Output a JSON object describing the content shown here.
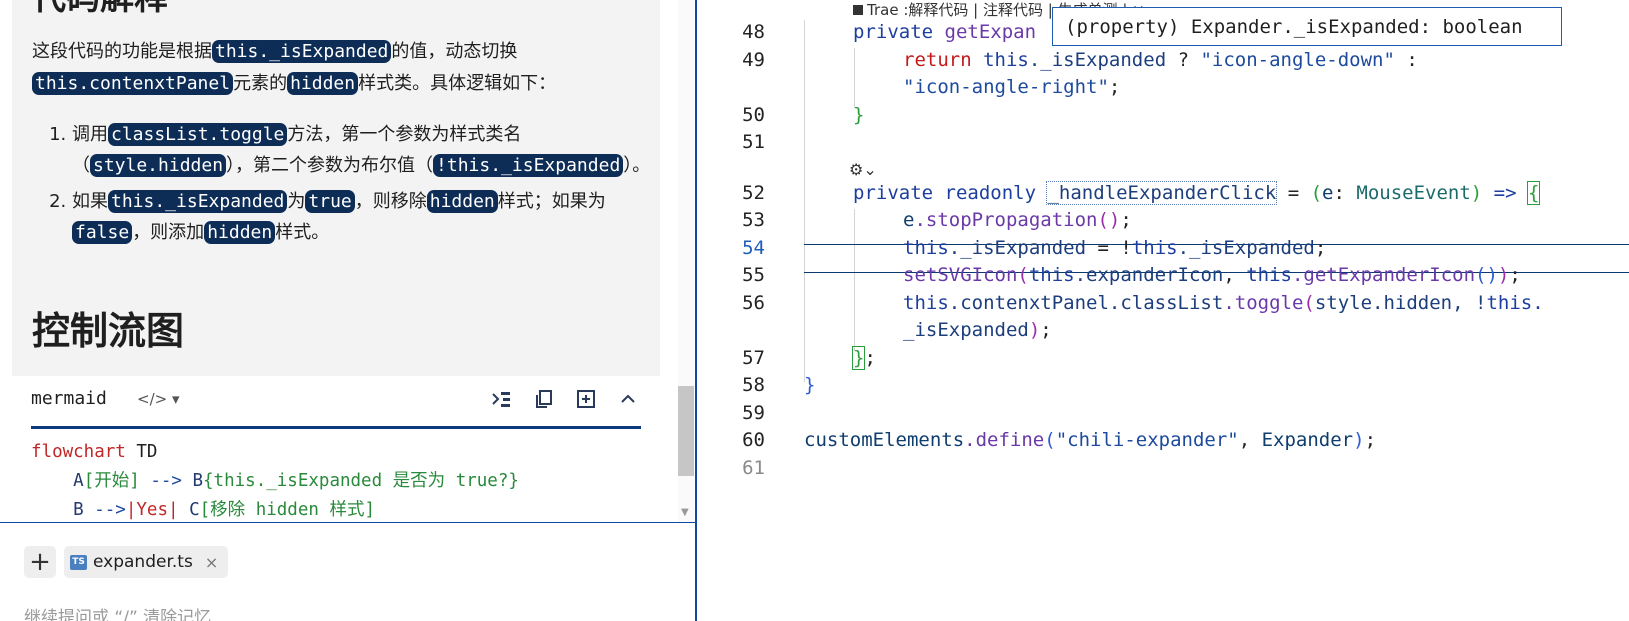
{
  "answer": {
    "heading_top": "代码解释",
    "para_prefix": "这段代码的功能是根据",
    "para_code1": "this._isExpanded",
    "para_mid": "的值，动态切换",
    "para_code2": "this.contenxtPanel",
    "para_mid2": "元素的",
    "para_code3": "hidden",
    "para_suffix": "样式类。具体逻辑如下：",
    "steps": [
      {
        "t1": "调用",
        "c1": "classList.toggle",
        "t2": "方法，第一个参数为样式类名（",
        "c2": "style.hidden",
        "t3": "），第二个参数为布尔值（",
        "c3": "!this._isExpanded",
        "t4": "）。"
      },
      {
        "t1": "如果",
        "c1": "this._isExpanded",
        "t2": "为",
        "c2": "true",
        "t3": "，则移除",
        "c3": "hidden",
        "t4": "样式；如果为",
        "c4": "false",
        "t5": "，则添加",
        "c5": "hidden",
        "t6": "样式。"
      }
    ],
    "heading2": "控制流图"
  },
  "code_block": {
    "lang": "mermaid",
    "tag_icon": "</>",
    "line1_kw": "flowchart",
    "line1_rest": " TD",
    "line2_a": "A",
    "line2_a_text": "[开始]",
    "line2_arrow": " --> ",
    "line2_b": "B",
    "line2_b_text": "{this._isExpanded 是否为 true?}",
    "line3_b": "B",
    "line3_arrow": " -->",
    "line3_label": "|Yes|",
    "line3_c": " C",
    "line3_c_text": "[移除 hidden 样式]"
  },
  "chat_input": {
    "add_label": "+",
    "file_chip_name": "expander.ts",
    "file_chip_icon": "TS",
    "close_label": "×",
    "placeholder": "继续提问或 “/” 清除记忆"
  },
  "editor": {
    "codelens": "Trae :解释代码 | 注释代码 | 生成单测 | ×",
    "hover_text": "(property) Expander._isExpanded: boolean",
    "line_numbers": [
      "48",
      "49",
      "",
      "50",
      "51",
      "",
      "52",
      "53",
      "54",
      "55",
      "56",
      "",
      "57",
      "58",
      "59",
      "60",
      "61"
    ],
    "active_line": "54",
    "lines": {
      "l48_kw": "private",
      "l48_fn": "getExpan",
      "l49_ret": "return",
      "l49_this": "this",
      "l49_prop": "._isExpanded",
      "l49_q": " ? ",
      "l49_s1": "\"icon-angle-down\"",
      "l49_colon": " :",
      "l49b_s2": "\"icon-angle-right\"",
      "l49b_semi": ";",
      "l50": "}",
      "l52_kw": "private readonly",
      "l52_name": "_handleExpanderClick",
      "l52_eq": " = ",
      "l52_p1": "(",
      "l52_e": "e",
      "l52_colon": ": ",
      "l52_type": "MouseEvent",
      "l52_p2": ")",
      "l52_arrow": " => ",
      "l52_brace": "{",
      "l53_e": "e",
      "l53_fn": ".stopPropagation",
      "l53_paren": "()",
      "l53_semi": ";",
      "l54_this": "this",
      "l54_prop": "._isExpanded",
      "l54_eq": " = !",
      "l54_this2": "this",
      "l54_prop2": "._isExpanded",
      "l54_semi": ";",
      "l55_fn": "setSVGIcon",
      "l55_p1": "(",
      "l55_this": "this",
      "l55_prop": ".expanderIcon",
      "l55_comma": ", ",
      "l55_this2": "this",
      "l55_fn2": ".getExpanderIcon",
      "l55_p2": "()",
      "l55_p3": ")",
      "l55_semi": ";",
      "l56_this": "this",
      "l56_prop": ".contenxtPanel.classList",
      "l56_fn": ".toggle",
      "l56_p1": "(",
      "l56_args": "style.hidden, !",
      "l56_this2": "this.",
      "l56b_prop": "_isExpanded",
      "l56b_p": ")",
      "l56b_semi": ";",
      "l57_brace": "}",
      "l57_semi": ";",
      "l58": "}",
      "l60_id": "customElements",
      "l60_fn": ".define",
      "l60_p1": "(",
      "l60_str": "\"chili-expander\"",
      "l60_comma": ", ",
      "l60_id2": "Expander",
      "l60_p2": ")",
      "l60_semi": ";"
    }
  }
}
